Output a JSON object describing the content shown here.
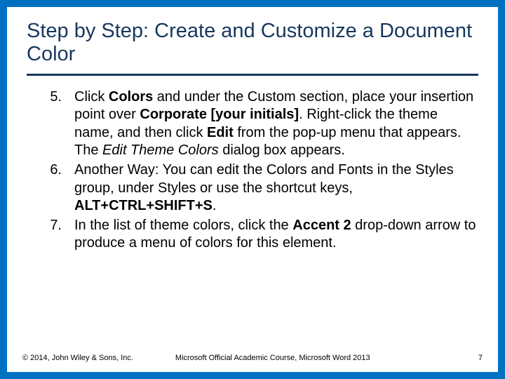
{
  "title": "Step by Step: Create and Customize a Document Color",
  "steps": [
    {
      "num": "5.",
      "segments": [
        {
          "t": "Click "
        },
        {
          "t": "Colors",
          "b": true
        },
        {
          "t": " and under the Custom section, place your insertion point over "
        },
        {
          "t": "Corporate [your initials]",
          "b": true
        },
        {
          "t": ". Right-click the theme name, and then click "
        },
        {
          "t": "Edit",
          "b": true
        },
        {
          "t": " from the pop-up menu that appears. The "
        },
        {
          "t": "Edit Theme Colors",
          "i": true
        },
        {
          "t": " dialog box appears."
        }
      ]
    },
    {
      "num": "6.",
      "segments": [
        {
          "t": "Another Way: You can edit the Colors and Fonts in the Styles group, under Styles or use the shortcut keys, "
        },
        {
          "t": "ALT+CTRL+SHIFT+S",
          "b": true
        },
        {
          "t": "."
        }
      ]
    },
    {
      "num": "7.",
      "segments": [
        {
          "t": "In the list of theme colors, click the "
        },
        {
          "t": "Accent 2",
          "b": true
        },
        {
          "t": " drop-down arrow to produce a menu of colors for this element."
        }
      ]
    }
  ],
  "footer": {
    "copyright": "© 2014, John Wiley & Sons, Inc.",
    "course": "Microsoft Official Academic Course, Microsoft Word 2013",
    "page": "7"
  }
}
